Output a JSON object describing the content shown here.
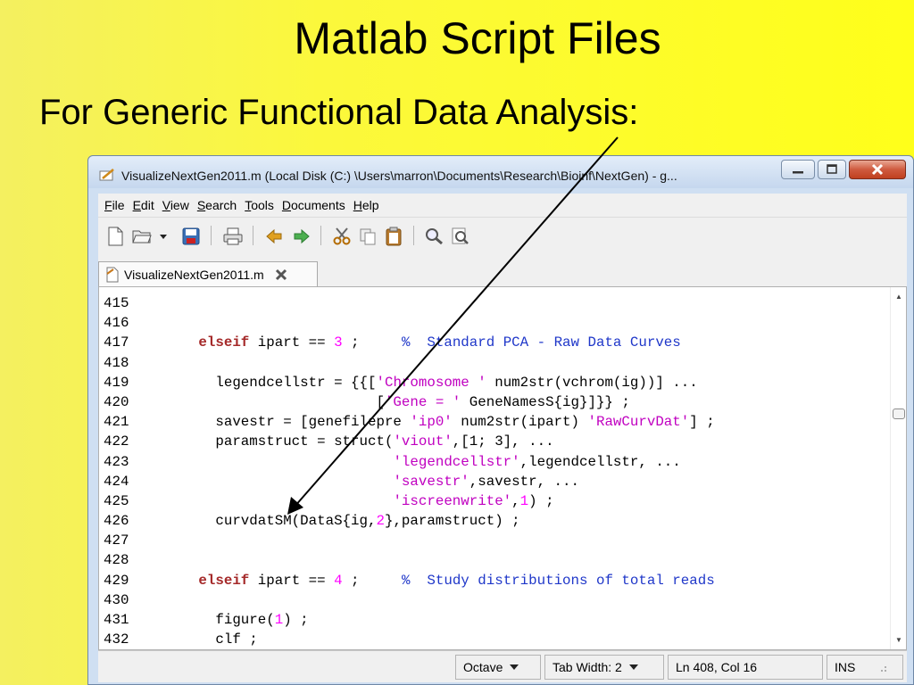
{
  "slide": {
    "title": "Matlab Script Files",
    "subtitle": "For Generic Functional Data Analysis:"
  },
  "window": {
    "title": "VisualizeNextGen2011.m (Local Disk (C:) \\Users\\marron\\Documents\\Research\\Bioinf\\NextGen) - g...",
    "controls": {
      "minimize_icon": "minimize-icon",
      "maximize_icon": "maximize-icon",
      "close_icon": "close-icon"
    }
  },
  "menu": {
    "file": {
      "mn": "F",
      "rest": "ile"
    },
    "edit": {
      "mn": "E",
      "rest": "dit"
    },
    "view": {
      "mn": "V",
      "rest": "iew"
    },
    "search": {
      "mn": "S",
      "rest": "earch"
    },
    "tools": {
      "mn": "T",
      "rest": "ools"
    },
    "documents": {
      "mn": "D",
      "rest": "ocuments"
    },
    "help": {
      "mn": "H",
      "rest": "elp"
    }
  },
  "toolbar": {
    "icons": [
      "new-document-icon",
      "open-folder-icon",
      "dropdown-arrow-icon",
      "save-icon",
      "print-icon",
      "undo-icon",
      "redo-icon",
      "cut-icon",
      "copy-icon",
      "paste-icon",
      "find-icon",
      "replace-icon"
    ]
  },
  "tab": {
    "label": "VisualizeNextGen2011.m"
  },
  "code": {
    "lines": [
      {
        "n": "415",
        "parts": []
      },
      {
        "n": "416",
        "parts": []
      },
      {
        "n": "417",
        "parts": [
          [
            "p",
            "     "
          ],
          [
            "kw",
            "elseif"
          ],
          [
            "p",
            " ipart == "
          ],
          [
            "num",
            "3"
          ],
          [
            "p",
            " ;     "
          ],
          [
            "cmt",
            "%  Standard PCA - Raw Data Curves"
          ]
        ]
      },
      {
        "n": "418",
        "parts": []
      },
      {
        "n": "419",
        "parts": [
          [
            "p",
            "       legendcellstr = {{["
          ],
          [
            "str",
            "'Chromosome '"
          ],
          [
            "p",
            " num2str(vchrom(ig))] ..."
          ]
        ]
      },
      {
        "n": "420",
        "parts": [
          [
            "p",
            "                          ["
          ],
          [
            "str",
            "'Gene = '"
          ],
          [
            "p",
            " GeneNamesS{ig}]}} ;"
          ]
        ]
      },
      {
        "n": "421",
        "parts": [
          [
            "p",
            "       savestr = [genefilepre "
          ],
          [
            "str",
            "'ip0'"
          ],
          [
            "p",
            " num2str(ipart) "
          ],
          [
            "str",
            "'RawCurvDat'"
          ],
          [
            "p",
            "] ;"
          ]
        ]
      },
      {
        "n": "422",
        "parts": [
          [
            "p",
            "       paramstruct = struct("
          ],
          [
            "str",
            "'viout'"
          ],
          [
            "p",
            ",[1; 3], ..."
          ]
        ]
      },
      {
        "n": "423",
        "parts": [
          [
            "p",
            "                            "
          ],
          [
            "str",
            "'legendcellstr'"
          ],
          [
            "p",
            ",legendcellstr, ..."
          ]
        ]
      },
      {
        "n": "424",
        "parts": [
          [
            "p",
            "                            "
          ],
          [
            "str",
            "'savestr'"
          ],
          [
            "p",
            ",savestr, ..."
          ]
        ]
      },
      {
        "n": "425",
        "parts": [
          [
            "p",
            "                            "
          ],
          [
            "str",
            "'iscreenwrite'"
          ],
          [
            "p",
            ","
          ],
          [
            "num",
            "1"
          ],
          [
            "p",
            ") ;"
          ]
        ]
      },
      {
        "n": "426",
        "parts": [
          [
            "p",
            "       curvdatSM(DataS{ig,"
          ],
          [
            "num",
            "2"
          ],
          [
            "p",
            "},paramstruct) ;"
          ]
        ]
      },
      {
        "n": "427",
        "parts": []
      },
      {
        "n": "428",
        "parts": []
      },
      {
        "n": "429",
        "parts": [
          [
            "p",
            "     "
          ],
          [
            "kw",
            "elseif"
          ],
          [
            "p",
            " ipart == "
          ],
          [
            "num",
            "4"
          ],
          [
            "p",
            " ;     "
          ],
          [
            "cmt",
            "%  Study distributions of total reads"
          ]
        ]
      },
      {
        "n": "430",
        "parts": []
      },
      {
        "n": "431",
        "parts": [
          [
            "p",
            "       figure("
          ],
          [
            "num",
            "1"
          ],
          [
            "p",
            ") ;"
          ]
        ]
      },
      {
        "n": "432",
        "parts": [
          [
            "p",
            "       clf ;"
          ]
        ]
      }
    ]
  },
  "status": {
    "language": "Octave",
    "tab_width": "Tab Width:  2",
    "position": "Ln 408, Col 16",
    "mode": "INS"
  },
  "colors": {
    "keyword": "#a52a2a",
    "string": "#c000c0",
    "number": "#ff00ff",
    "comment": "#1f37c9",
    "background_yellow": "#ffff1a"
  }
}
